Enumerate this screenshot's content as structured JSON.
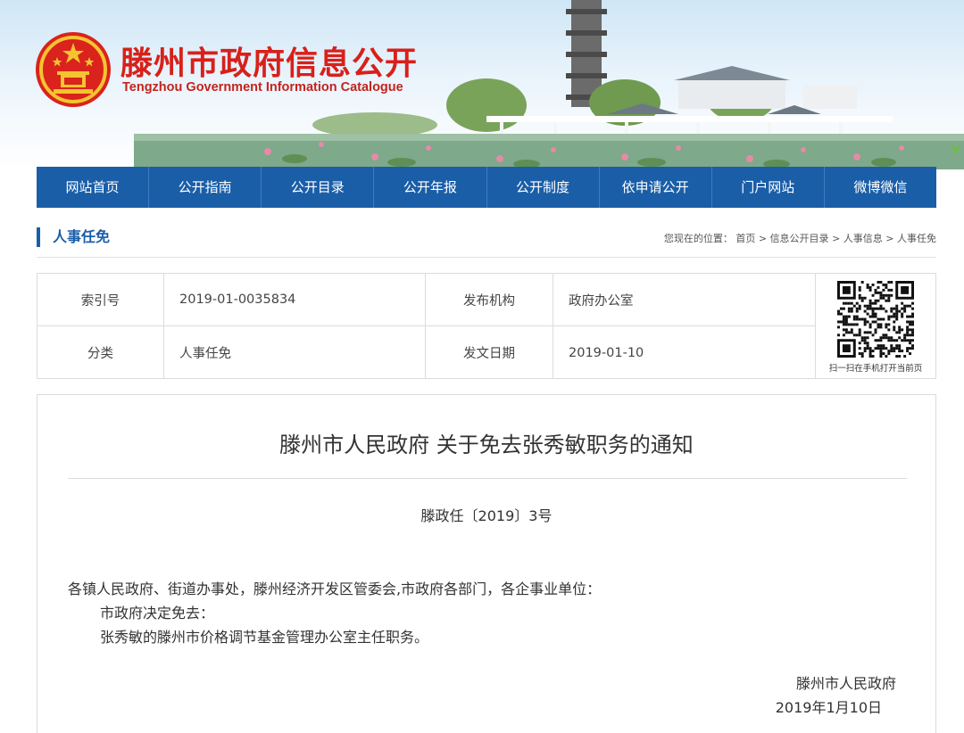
{
  "header": {
    "title": "滕州市政府信息公开",
    "subtitle": "Tengzhou Government Information Catalogue",
    "edge_mark": "Y"
  },
  "nav": {
    "items": [
      "网站首页",
      "公开指南",
      "公开目录",
      "公开年报",
      "公开制度",
      "依申请公开",
      "门户网站",
      "微博微信"
    ]
  },
  "section": {
    "title": "人事任免",
    "breadcrumb": {
      "prefix": "您现在的位置：",
      "items": [
        "首页",
        "信息公开目录",
        "人事信息",
        "人事任免"
      ],
      "separator": ">"
    }
  },
  "meta": {
    "index_label": "索引号",
    "index_value": "2019-01-0035834",
    "publisher_label": "发布机构",
    "publisher_value": "政府办公室",
    "category_label": "分类",
    "category_value": "人事任免",
    "date_label": "发文日期",
    "date_value": "2019-01-10",
    "qr_caption": "扫一扫在手机打开当前页"
  },
  "article": {
    "title": "滕州市人民政府 关于免去张秀敏职务的通知",
    "doc_number": "滕政任〔2019〕3号",
    "salutation": "各镇人民政府、街道办事处，滕州经济开发区管委会,市政府各部门，各企事业单位：",
    "paragraph1": "市政府决定免去：",
    "paragraph2": "张秀敏的滕州市价格调节基金管理办公室主任职务。",
    "signature": "滕州市人民政府",
    "date": "2019年1月10日"
  },
  "colors": {
    "brand_red": "#d8201a",
    "nav_blue": "#1a5ea8"
  }
}
